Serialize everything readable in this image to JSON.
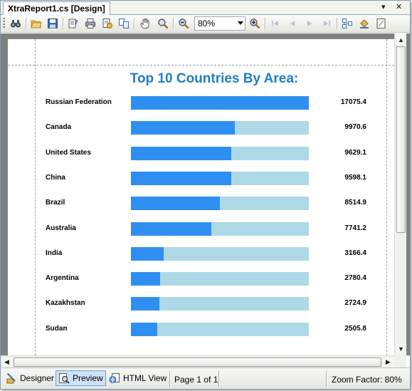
{
  "window": {
    "tab_title": "XtraReport1.cs [Design]",
    "dropdown_glyph": "▾",
    "close_glyph": "✕"
  },
  "toolbar": {
    "zoom_value": "80%",
    "icons": [
      "binoculars-icon",
      "open-icon",
      "save-icon",
      "page-setup-icon",
      "print-icon",
      "print-dialog-icon",
      "multi-page-icon",
      "hand-tool-icon",
      "magnifier-icon",
      "zoom-out-icon",
      "zoom-in-icon",
      "first-page-icon",
      "previous-page-icon",
      "next-page-icon",
      "last-page-icon",
      "document-map-icon",
      "background-color-icon",
      "watermark-icon"
    ]
  },
  "report": {
    "title": "Top 10 Countries By Area:",
    "max_value": 17075.4,
    "rows": [
      {
        "country": "Russian Federation",
        "value": 17075.4,
        "value_text": "17075.4"
      },
      {
        "country": "Canada",
        "value": 9970.6,
        "value_text": "9970.6"
      },
      {
        "country": "United States",
        "value": 9629.1,
        "value_text": "9629.1"
      },
      {
        "country": "China",
        "value": 9598.1,
        "value_text": "9598.1"
      },
      {
        "country": "Brazil",
        "value": 8514.9,
        "value_text": "8514.9"
      },
      {
        "country": "Australia",
        "value": 7741.2,
        "value_text": "7741.2"
      },
      {
        "country": "India",
        "value": 3166.4,
        "value_text": "3166.4"
      },
      {
        "country": "Argentina",
        "value": 2780.4,
        "value_text": "2780.4"
      },
      {
        "country": "Kazakhstan",
        "value": 2724.9,
        "value_text": "2724.9"
      },
      {
        "country": "Sudan",
        "value": 2505.8,
        "value_text": "2505.8"
      }
    ]
  },
  "colors": {
    "title": "#1f7fc4",
    "bar_fill": "#2f8ff0",
    "bar_track": "#add8e6"
  },
  "bottom": {
    "designer_label": "Designer",
    "preview_label": "Preview",
    "html_view_label": "HTML View",
    "page_status": "Page 1 of 1",
    "zoom_status": "Zoom Factor: 80%"
  }
}
